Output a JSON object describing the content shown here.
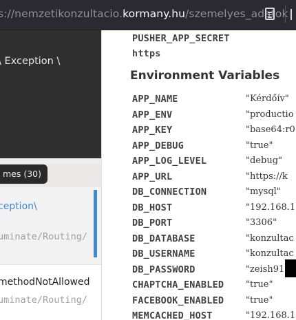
{
  "browser": {
    "url_prefix": "s://nemzetikonzultacio.",
    "url_domain": "kormany.hu",
    "url_suffix": "/szemelyes_adatok"
  },
  "left": {
    "exception_title": "\\ Exception \\",
    "frames_badge": "mes (30)",
    "frames": [
      {
        "class": "ception\\",
        "file": "uminate/Routing/"
      },
      {
        "class": "methodNotAllowed",
        "file": "uminate/Routing/"
      }
    ]
  },
  "top_rows": [
    {
      "key": "PUSHER_APP_SECRET"
    },
    {
      "key": "https"
    }
  ],
  "env_section_title": "Environment Variables",
  "env": [
    {
      "key": "APP_NAME",
      "value": "\"Kérdőív\""
    },
    {
      "key": "APP_ENV",
      "value": "\"productio"
    },
    {
      "key": "APP_KEY",
      "value": "\"base64:r0"
    },
    {
      "key": "APP_DEBUG",
      "value": "\"true\""
    },
    {
      "key": "APP_LOG_LEVEL",
      "value": "\"debug\""
    },
    {
      "key": "APP_URL",
      "value": "\"https://k"
    },
    {
      "key": "DB_CONNECTION",
      "value": "\"mysql\""
    },
    {
      "key": "DB_HOST",
      "value": "\"192.168.1"
    },
    {
      "key": "DB_PORT",
      "value": "\"3306\""
    },
    {
      "key": "DB_DATABASE",
      "value": "\"konzultac"
    },
    {
      "key": "DB_USERNAME",
      "value": "\"konzultac"
    },
    {
      "key": "DB_PASSWORD",
      "value": "\"zeish91"
    },
    {
      "key": "CHAPTCHA_ENABLED",
      "value": "\"true\""
    },
    {
      "key": "FACEBOOK_ENABLED",
      "value": "\"true\""
    },
    {
      "key": "MEMCACHED_HOST",
      "value": "\"192.168.1"
    }
  ]
}
